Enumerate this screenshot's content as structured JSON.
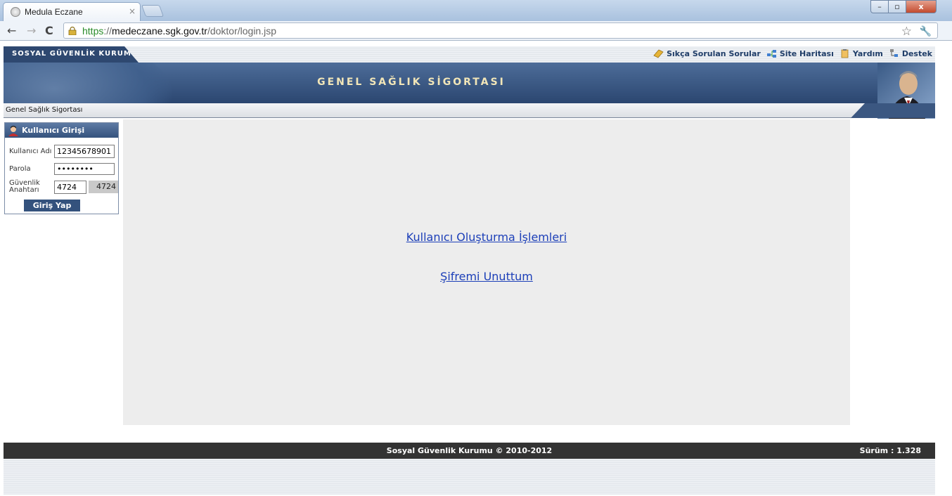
{
  "browser": {
    "tab_title": "Medula Eczane",
    "tab_close": "×",
    "url_scheme": "https",
    "url_sep": "://",
    "url_host": "medeczane.sgk.gov.tr",
    "url_path": "/doktor/login.jsp",
    "min_glyph": "–",
    "max_glyph": "▫",
    "close_glyph": "x"
  },
  "header": {
    "org_name": "SOSYAL GÜVENLİK KURUMU",
    "links": {
      "faq": "Sıkça Sorulan Sorular",
      "sitemap": "Site Haritası",
      "help": "Yardım",
      "support": "Destek"
    },
    "banner_title": "GENEL SAĞLIK SİGORTASI",
    "breadcrumb": "Genel Sağlık Sigortası"
  },
  "login": {
    "title": "Kullanıcı Girişi",
    "username_label": "Kullanıcı Adı",
    "username_value": "12345678901",
    "password_label": "Parola",
    "password_value": "••••••••",
    "security_label": "Güvenlik Anahtarı",
    "security_value": "4724",
    "captcha": "4724",
    "submit": "Giriş Yap"
  },
  "main": {
    "create_user": "Kullanıcı Oluşturma İşlemleri",
    "forgot_password": "Şifremi Unuttum"
  },
  "footer": {
    "copyright": "Sosyal Güvenlik Kurumu © 2010-2012",
    "version": "Sürüm : 1.328"
  },
  "colors": {
    "brand_navy": "#2e4870",
    "banner_gold": "#f2e6b8",
    "link_blue": "#1c3fb8",
    "footer_bg": "#333333"
  }
}
